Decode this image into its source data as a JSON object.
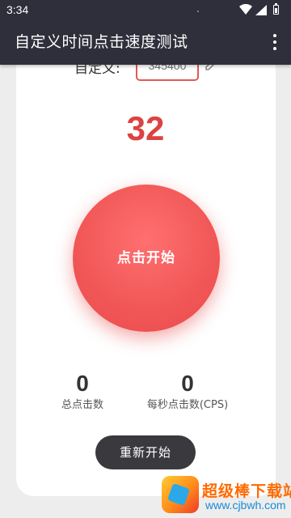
{
  "status_bar": {
    "time": "3:34",
    "icons": [
      "wifi-icon",
      "signal-icon",
      "battery-icon"
    ]
  },
  "app_bar": {
    "title": "自定义时间点击速度测试",
    "overflow_icon": "more-vert-icon"
  },
  "config": {
    "label": "自定义:",
    "time_input_value": "345400",
    "edit_icon": "edit-icon"
  },
  "countdown": "32",
  "click_button_label": "点击开始",
  "stats": {
    "total_clicks_value": "0",
    "total_clicks_label": "总点击数",
    "cps_value": "0",
    "cps_label": "每秒点击数(CPS)"
  },
  "restart_button_label": "重新开始",
  "watermark": {
    "title": "超级棒下载站",
    "url": "www.cjbwh.com"
  },
  "colors": {
    "app_bar": "#2f2f3c",
    "accent_red": "#dd4242",
    "button_red": "#f25858",
    "restart_button": "#3a3a3e"
  }
}
